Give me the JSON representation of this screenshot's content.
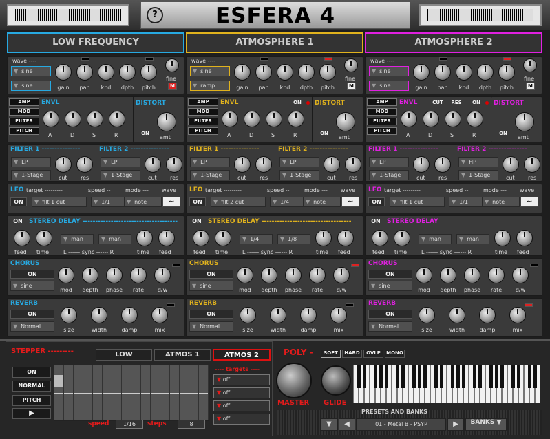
{
  "header": {
    "title": "ESFERA 4",
    "help": "?"
  },
  "columns": [
    {
      "key": "low",
      "title": "LOW FREQUENCY",
      "color": "#27a9e1",
      "wave_label": "wave ----",
      "osc1": "sine",
      "osc2": "sine",
      "knobs": [
        "gain",
        "pan",
        "kbd",
        "dpth",
        "pitch"
      ],
      "fine": "fine",
      "m": "M",
      "env_title": "ENVL",
      "env_btns": [
        "AMP",
        "MOD",
        "FILTER",
        "PITCH"
      ],
      "adsr": [
        "A",
        "D",
        "S",
        "R"
      ],
      "env_extra": [],
      "env_on": "",
      "distort": "DISTORT",
      "dist_on": "ON",
      "amt": "amt",
      "filter1": "FILTER 1 ---------------",
      "filter2": "FILTER 2 ---------------",
      "f1_type": "LP",
      "f1_stage": "1-Stage",
      "f2_type": "LP",
      "f2_stage": "1-Stage",
      "cut": "cut",
      "res": "res",
      "lfo": "LFO",
      "lfo_target": "target ---------",
      "lfo_speed": "speed --",
      "lfo_mode": "mode ---",
      "lfo_wave": "wave",
      "lfo_on": "ON",
      "lfo_t": "filt 1 cut",
      "lfo_s": "1/1",
      "lfo_m": "note",
      "delay_on": "ON",
      "delay": "STEREO DELAY -------------------------------------",
      "feed": "feed",
      "time": "time",
      "sync_l": "man",
      "sync_r": "man",
      "sync_label": "L ------ sync ------ R",
      "chorus": "CHORUS",
      "ch_on": "ON",
      "ch_wave": "sine",
      "ch_knobs": [
        "mod",
        "depth",
        "phase",
        "rate",
        "d/w"
      ],
      "reverb": "REVERB",
      "rv_on": "ON",
      "rv_mode": "Normal",
      "rv_knobs": [
        "size",
        "width",
        "damp",
        "mix"
      ]
    },
    {
      "key": "atm1",
      "title": "ATMOSPHERE 1",
      "color": "#e0b21d",
      "wave_label": "wave ----",
      "osc1": "sine",
      "osc2": "ramp",
      "knobs": [
        "gain",
        "pan",
        "kbd",
        "dpth",
        "pitch"
      ],
      "fine": "fine",
      "m": "M",
      "env_title": "ENVL",
      "env_btns": [
        "AMP",
        "MOD",
        "FILTER",
        "PITCH"
      ],
      "adsr": [
        "A",
        "D",
        "S",
        "R"
      ],
      "env_extra": [],
      "env_on": "ON",
      "distort": "DISTORT",
      "dist_on": "ON",
      "amt": "amt",
      "filter1": "FILTER 1 ---------------",
      "filter2": "FILTER 2 ---------------",
      "f1_type": "LP",
      "f1_stage": "1-Stage",
      "f2_type": "LP",
      "f2_stage": "1-Stage",
      "cut": "cut",
      "res": "res",
      "lfo": "LFO",
      "lfo_target": "target ---------",
      "lfo_speed": "speed --",
      "lfo_mode": "mode ---",
      "lfo_wave": "wave",
      "lfo_on": "ON",
      "lfo_t": "filt 2 cut",
      "lfo_s": "1/4",
      "lfo_m": "note",
      "delay_on": "ON",
      "delay": "STEREO DELAY -----------------------------------",
      "feed": "feed",
      "time": "time",
      "sync_l": "1/4",
      "sync_r": "1/8",
      "sync_label": "L ------ sync ------ R",
      "chorus": "CHORUS",
      "ch_on": "ON",
      "ch_wave": "sine",
      "ch_knobs": [
        "mod",
        "depth",
        "phase",
        "rate",
        "d/w"
      ],
      "reverb": "REVERB",
      "rv_on": "ON",
      "rv_mode": "Normal",
      "rv_knobs": [
        "size",
        "width",
        "damp",
        "mix"
      ]
    },
    {
      "key": "atm2",
      "title": "ATMOSPHERE 2",
      "color": "#e020e0",
      "wave_label": "wave ----",
      "osc1": "sine",
      "osc2": "sine",
      "knobs": [
        "gain",
        "pan",
        "kbd",
        "dpth",
        "pitch"
      ],
      "fine": "fine",
      "m": "M",
      "env_title": "ENVL",
      "env_btns": [
        "AMP",
        "MOD",
        "FILTER",
        "PITCH"
      ],
      "adsr": [
        "A",
        "D",
        "S",
        "R"
      ],
      "env_extra": [
        "CUT",
        "RES"
      ],
      "env_on": "ON",
      "distort": "DISTORT",
      "dist_on": "ON",
      "amt": "amt",
      "filter1": "FILTER 1 ---------------",
      "filter2": "FILTER 2 ---------------",
      "f1_type": "LP",
      "f1_stage": "1-Stage",
      "f2_type": "HP",
      "f2_stage": "1-Stage",
      "cut": "cut",
      "res": "res",
      "lfo": "LFO",
      "lfo_target": "target ---------",
      "lfo_speed": "speed --",
      "lfo_mode": "mode ---",
      "lfo_wave": "wave",
      "lfo_on": "ON",
      "lfo_t": "filt 1 cut",
      "lfo_s": "1/1",
      "lfo_m": "note",
      "delay_on": "ON",
      "delay": "STEREO DELAY",
      "feed": "feed",
      "time": "time",
      "sync_l": "man",
      "sync_r": "man",
      "sync_label": "L ------ sync ------ R",
      "chorus": "CHORUS",
      "ch_on": "ON",
      "ch_wave": "sine",
      "ch_knobs": [
        "mod",
        "depth",
        "phase",
        "rate",
        "d/w"
      ],
      "reverb": "REVERB",
      "rv_on": "ON",
      "rv_mode": "Normal",
      "rv_knobs": [
        "size",
        "width",
        "damp",
        "mix"
      ]
    }
  ],
  "stepper": {
    "title": "STEPPER ---------",
    "tabs": [
      "LOW",
      "ATMOS 1",
      "ATMOS 2"
    ],
    "buttons": [
      "ON",
      "NORMAL",
      "PITCH",
      "▶"
    ],
    "targets_label": "---- targets ----",
    "targets": [
      "off",
      "off",
      "off",
      "off"
    ],
    "speed_label": "speed",
    "speed": "1/16",
    "steps_label": "steps",
    "steps": "8"
  },
  "poly": {
    "title": "POLY -",
    "modes": [
      "SOFT",
      "HARD",
      "OVLP",
      "MONO"
    ],
    "master": "MASTER",
    "glide": "GLIDE"
  },
  "presets": {
    "label": "PRESETS AND BANKS",
    "current": "01 - Metal B - PSYP",
    "banks": "BANKS"
  }
}
